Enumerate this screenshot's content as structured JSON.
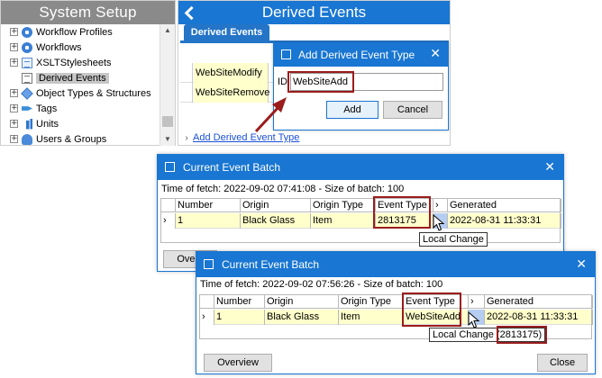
{
  "system_setup": {
    "title": "System Setup",
    "items": [
      {
        "label": "Workflow Profiles",
        "expander": "+",
        "icon": "gear-icon"
      },
      {
        "label": "Workflows",
        "expander": "+",
        "icon": "gear-icon"
      },
      {
        "label": "XSLTStylesheets",
        "expander": "+",
        "icon": "document-icon"
      },
      {
        "label": "Derived Events",
        "expander": "",
        "icon": "list-icon"
      },
      {
        "label": "Object Types & Structures",
        "expander": "+",
        "icon": "box-icon"
      },
      {
        "label": "Tags",
        "expander": "+",
        "icon": "tag-icon"
      },
      {
        "label": "Units",
        "expander": "+",
        "icon": "units-icon"
      },
      {
        "label": "Users & Groups",
        "expander": "+",
        "icon": "users-icon"
      }
    ],
    "selected": "Derived Events"
  },
  "derived_events": {
    "title": "Derived Events",
    "tab": "Derived Events",
    "rows": [
      "WebSiteModify",
      "WebSiteRemove"
    ],
    "add_link": "Add Derived Event Type"
  },
  "add_dialog": {
    "title": "Add Derived Event Type",
    "id_label": "ID:",
    "id_value": "WebSiteAdd",
    "add_label": "Add",
    "cancel_label": "Cancel"
  },
  "batch_1": {
    "title": "Current Event Batch",
    "fetch_info": "Time of fetch: 2022-09-02 07:41:08  -  Size of batch: 100",
    "columns": [
      "Number",
      "Origin",
      "Origin Type",
      "Event Type",
      "Generated"
    ],
    "row": {
      "number": "1",
      "origin": "Black Glass",
      "origin_type": "Item",
      "event_type": "2813175",
      "generated": "2022-08-31 11:33:31"
    },
    "tooltip": "Local Change",
    "overview_partial": "Overv"
  },
  "batch_2": {
    "title": "Current Event Batch",
    "fetch_info": "Time of fetch: 2022-09-02 07:56:26  -  Size of batch: 100",
    "columns": [
      "Number",
      "Origin",
      "Origin Type",
      "Event Type",
      "Generated"
    ],
    "row": {
      "number": "1",
      "origin": "Black Glass",
      "origin_type": "Item",
      "event_type": "WebSiteAdd",
      "generated": "2022-08-31 11:33:31"
    },
    "tooltip": "Local Change",
    "tooltip_value": "(2813175)",
    "overview_label": "Overview",
    "close_label": "Close"
  },
  "colors": {
    "accent": "#1976d2",
    "highlight_box": "#9b1c1c",
    "row_bg": "#ffffcc",
    "selected_cell": "#b5cdf0"
  },
  "glyphs": {
    "chev": "›",
    "close": "✕"
  }
}
